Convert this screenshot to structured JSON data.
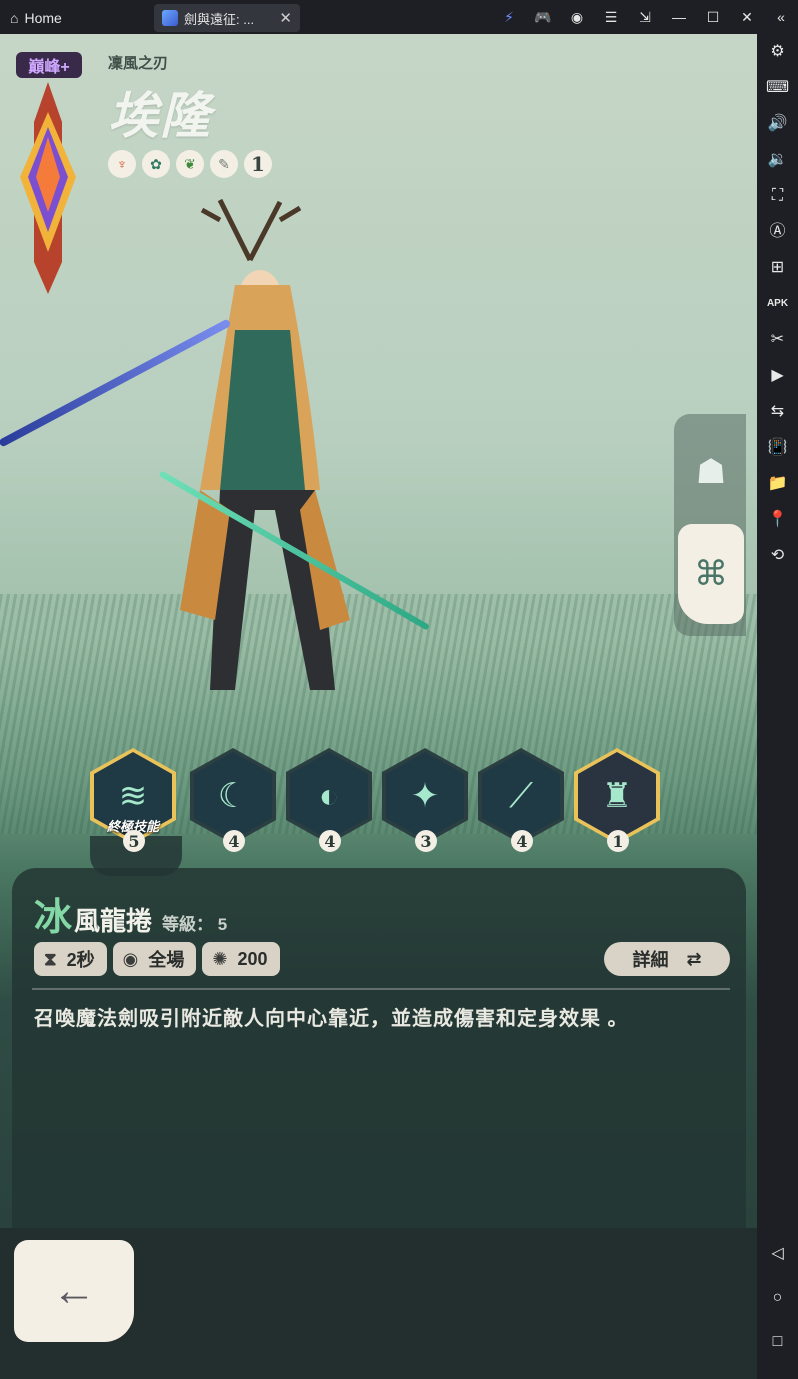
{
  "chrome": {
    "home_label": "Home",
    "game_tab_label": "劍與遠征: ...",
    "tab_close": "✕",
    "top_icons": [
      "⚡",
      "🎮",
      "◉",
      "☰",
      "⇲",
      "—",
      "☐",
      "✕",
      "«"
    ]
  },
  "sidebar": {
    "icons": [
      "⚙",
      "⌨",
      "🔊",
      "🔉",
      "⛶",
      "Ⓐ",
      "⊞",
      "APK",
      "✂",
      "▶",
      "⇆",
      "📳",
      "📁",
      "📍",
      "⟲",
      "◁",
      "○",
      "□"
    ]
  },
  "hero": {
    "rank_label": "巔峰+",
    "subtitle": "凜風之刃",
    "name": "埃隆",
    "factions": [
      "♆",
      "✿",
      "❦",
      "✎"
    ],
    "faction_number": "1"
  },
  "side_panel": {
    "top_icon": "☗",
    "bottom_icon": "⌘"
  },
  "skills": [
    {
      "icon": "≋",
      "level": "5",
      "label": "終極技能",
      "selected": true
    },
    {
      "icon": "☾",
      "level": "4"
    },
    {
      "icon": "◐",
      "level": "4"
    },
    {
      "icon": "✦",
      "level": "3"
    },
    {
      "icon": "⟋",
      "level": "4"
    },
    {
      "icon": "♜",
      "level": "1",
      "gold": true
    }
  ],
  "skill_info": {
    "title_first": "冰",
    "title_rest": "風龍捲",
    "level_text": "等級： 5",
    "cooldown": "2秒",
    "range": "全場",
    "energy": "200",
    "detail_label": "詳細",
    "description": "召喚魔法劍吸引附近敵人向中心靠近，並造成傷害和定身效果 。"
  },
  "back_icon": "←",
  "colors": {
    "accent_green": "#84d8a6",
    "panel": "#223432",
    "chip": "#d9d2c6",
    "gold": "#e9c35a"
  }
}
